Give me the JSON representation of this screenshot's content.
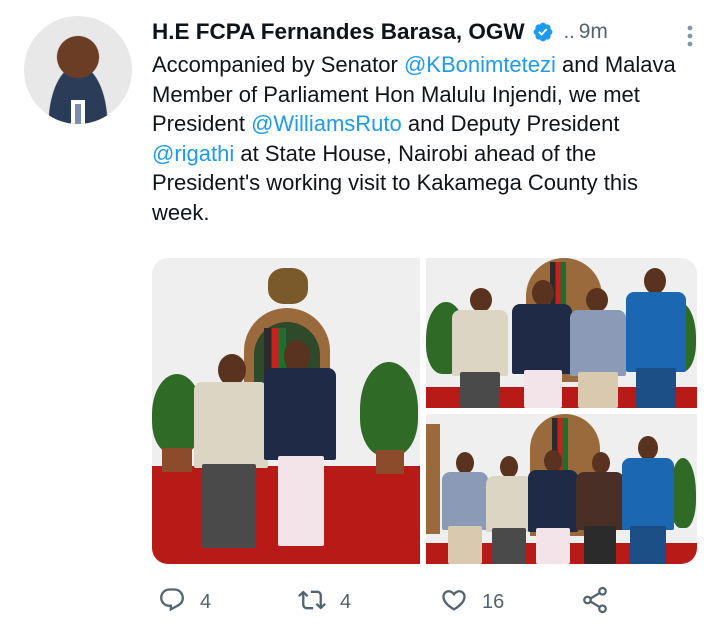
{
  "tweet": {
    "author_name": "H.E FCPA Fernandes Barasa, OGW",
    "separator": "..",
    "time": "9m",
    "text_segments": [
      {
        "text": "Accompanied by Senator ",
        "type": "text"
      },
      {
        "text": "@KBonimtetezi",
        "type": "mention"
      },
      {
        "text": " and Malava Member of Parliament Hon Malulu Injendi, we met President ",
        "type": "text"
      },
      {
        "text": "@WilliamsRuto",
        "type": "mention"
      },
      {
        "text": " and Deputy President ",
        "type": "text"
      },
      {
        "text": "@rigathi",
        "type": "mention"
      },
      {
        "text": " at State House, Nairobi ahead of the President's working visit to Kakamega County this week.",
        "type": "text"
      }
    ]
  },
  "actions": {
    "reply_count": "4",
    "retweet_count": "4",
    "like_count": "16"
  },
  "colors": {
    "accent": "#1d9bf0",
    "text": "#0f1419",
    "muted": "#536471",
    "carpet": "#b81a17"
  },
  "icons": [
    "verified-badge-icon",
    "more-vertical-icon",
    "reply-icon",
    "retweet-icon",
    "like-icon",
    "share-icon"
  ]
}
